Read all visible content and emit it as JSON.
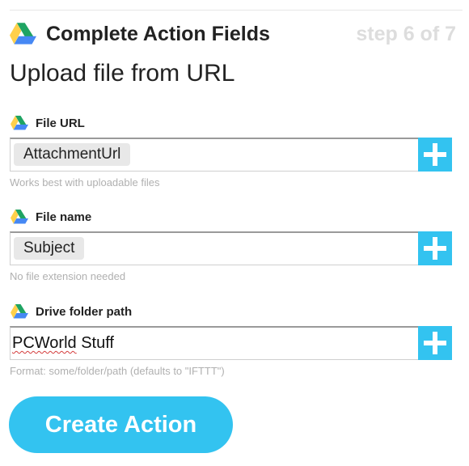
{
  "header": {
    "title": "Complete Action Fields",
    "step": "step 6 of 7"
  },
  "action": {
    "title": "Upload file from URL"
  },
  "fields": [
    {
      "label": "File URL",
      "token": "AttachmentUrl",
      "hint": "Works best with uploadable files"
    },
    {
      "label": "File name",
      "token": "Subject",
      "hint": "No file extension needed"
    },
    {
      "label": "Drive folder path",
      "value_misspelled": "PCWorld",
      "value_rest": " Stuff",
      "hint": "Format: some/folder/path (defaults to \"IFTTT\")"
    }
  ],
  "button": {
    "create_label": "Create Action"
  },
  "colors": {
    "accent": "#33c3f0",
    "token_bg": "#e8e8e8",
    "hint_text": "#b0b0b0",
    "step_text": "#dddddd",
    "drive_green": "#1fa463",
    "drive_yellow": "#ffd04b",
    "drive_blue": "#4688f4"
  },
  "icons": {
    "drive": "google-drive-icon",
    "add": "plus-icon"
  }
}
